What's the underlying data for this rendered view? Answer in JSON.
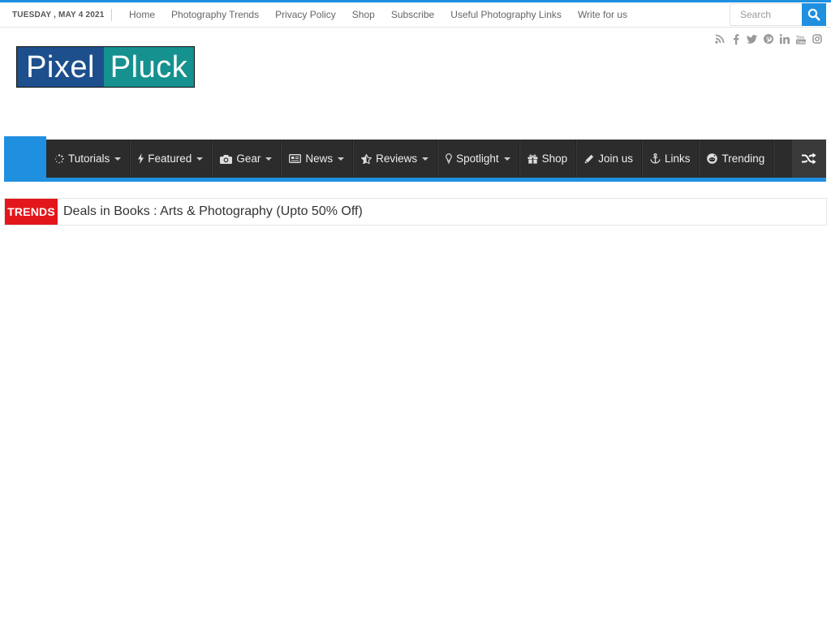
{
  "topbar": {
    "date": "TUESDAY , MAY 4 2021",
    "links": [
      "Home",
      "Photography Trends",
      "Privacy Policy",
      "Shop",
      "Subscribe",
      "Useful Photography Links",
      "Write for us"
    ],
    "search_placeholder": "Search"
  },
  "social_icons": [
    "rss-icon",
    "facebook-icon",
    "twitter-icon",
    "pinterest-icon",
    "linkedin-icon",
    "youtube-icon",
    "instagram-icon"
  ],
  "logo": {
    "part1": "Pixel",
    "part2": "Pluck"
  },
  "nav": {
    "items": [
      {
        "label": "Tutorials",
        "icon": "spinner-icon",
        "dropdown": true
      },
      {
        "label": "Featured",
        "icon": "bolt-icon",
        "dropdown": true
      },
      {
        "label": "Gear",
        "icon": "camera-icon",
        "dropdown": true
      },
      {
        "label": "News",
        "icon": "newspaper-icon",
        "dropdown": true
      },
      {
        "label": "Reviews",
        "icon": "star-half-icon",
        "dropdown": true
      },
      {
        "label": "Spotlight",
        "icon": "lightbulb-icon",
        "dropdown": true
      },
      {
        "label": "Shop",
        "icon": "gift-icon",
        "dropdown": false
      },
      {
        "label": "Join us",
        "icon": "pencil-icon",
        "dropdown": false
      },
      {
        "label": "Links",
        "icon": "anchor-icon",
        "dropdown": false
      },
      {
        "label": "Trending",
        "icon": "reddit-icon",
        "dropdown": false
      }
    ],
    "random_icon": "shuffle-icon"
  },
  "trends": {
    "label": "TRENDS",
    "headline": "Deals in Books : Arts & Photography (Upto 50% Off)"
  },
  "colors": {
    "accent": "#1f8fe0",
    "nav_bg": "#2c2c2c",
    "trends_label": "#e3171b",
    "logo_left": "#1d4f8c",
    "logo_right": "#15918f"
  }
}
